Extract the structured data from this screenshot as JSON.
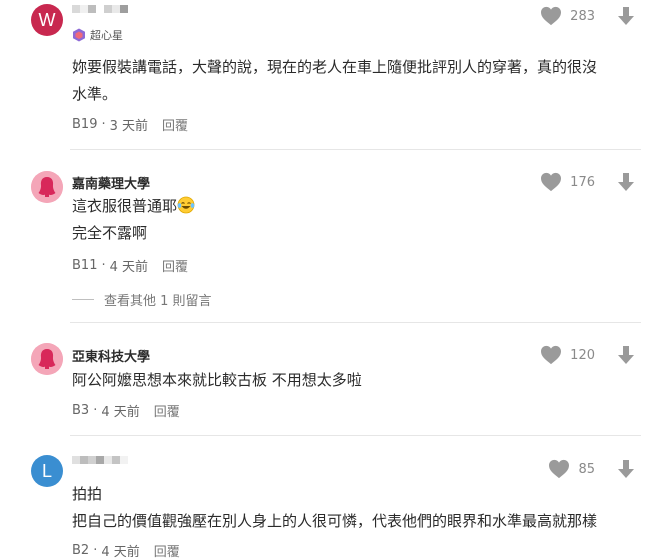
{
  "comments": [
    {
      "avatar_letter": "W",
      "badge": "超心星",
      "lines": [
        "妳要假裝講電話，大聲的說，現在的老人在車上隨便批評別人的穿著，真的很沒",
        "水準。"
      ],
      "floor": "B19",
      "time": "3 天前",
      "reply_label": "回覆",
      "likes": "283"
    },
    {
      "school": "嘉南藥理大學",
      "lines": [
        "這衣服很普通耶",
        "完全不露啊"
      ],
      "floor": "B11",
      "time": "4 天前",
      "reply_label": "回覆",
      "likes": "176",
      "more_replies": "查看其他 1 則留言"
    },
    {
      "school": "亞東科技大學",
      "lines": [
        "阿公阿嬤思想本來就比較古板 不用想太多啦"
      ],
      "floor": "B3",
      "time": "4 天前",
      "reply_label": "回覆",
      "likes": "120"
    },
    {
      "avatar_letter": "L",
      "lines": [
        "拍拍",
        "把自己的價值觀強壓在別人身上的人很可憐，代表他們的眼界和水準最高就那樣"
      ],
      "floor": "B2",
      "time": "4 天前",
      "reply_label": "回覆",
      "likes": "85"
    }
  ],
  "colors": {
    "avatar_w": "#c8284f",
    "avatar_l": "#3a8ed1",
    "avatar_school": "#f4a6b8",
    "icon_gray": "#9a9a9a"
  },
  "icons": {
    "like": "heart-icon",
    "dislike": "arrow-down-icon",
    "badge": "hexagon-badge-icon",
    "emoji": "tears-of-joy-emoji"
  }
}
